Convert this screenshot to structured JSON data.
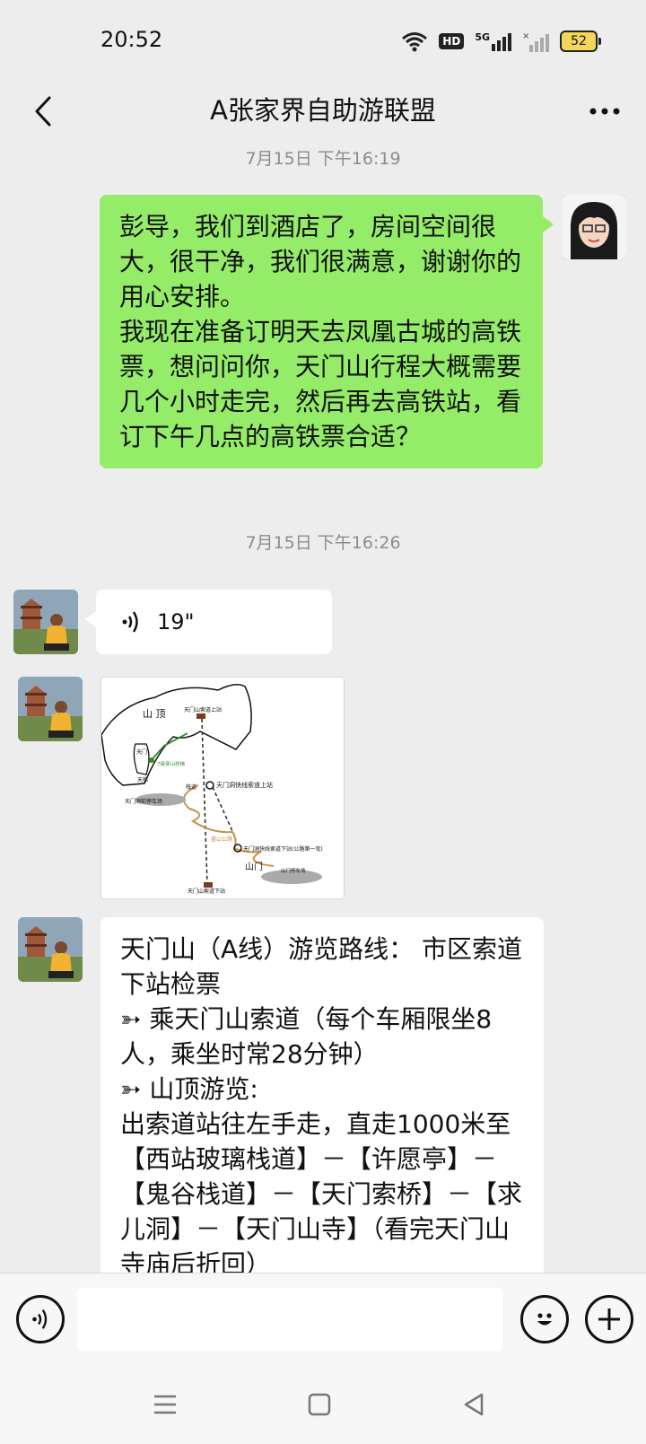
{
  "status_bar": {
    "time": "20:52",
    "hd_label": "HD",
    "net_label": "5G",
    "battery": "52"
  },
  "header": {
    "title": "A张家界自助游联盟"
  },
  "messages": {
    "ts1": "7月15日 下午16:19",
    "me_text_p1": "彭导，我们到酒店了，房间空间很大，很干净，我们很满意，谢谢你的用心安排。",
    "me_text_p2": "我现在准备订明天去凤凰古城的高铁票，想问问你，天门山行程大概需要几个小时走完，然后再去高铁站，看订下午几点的高铁票合适？",
    "ts2": "7月15日 下午16:26",
    "voice_duration": "19\"",
    "route_lines": [
      "天门山（A线）游览路线：  市区索道下站检票",
      "➳ 乘天门山索道（每个车厢限坐8人，乘坐时常28分钟）",
      "➳ 山顶游览:",
      "出索道站往左手走，直走1000米至【西站玻璃栈道】－【许愿亭】－【鬼谷栈道】－【天门索桥】－【求儿洞】－【天门山寺】（看完天门山寺庙后折回）"
    ]
  },
  "map": {
    "labels": {
      "summit": "山  顶",
      "cable_top": "天门山索道上站",
      "tianmen": "天门",
      "escalator": "7级穿山扶梯",
      "stairs": "天梯",
      "plank": "栈道",
      "express_top": "天门洞快线索道上站",
      "cave_parking": "天门洞前停车场",
      "road": "盘山公路",
      "express_bottom": "天门洞快线索道下站(公路第一弯)",
      "gate": "山门",
      "gate_parking": "山门停车场",
      "cable_bottom": "天门山索道下站"
    },
    "colors": {
      "cable": "#333333",
      "escalator": "#2e8b2e",
      "road": "#c8924a"
    }
  },
  "input": {
    "placeholder": ""
  },
  "colors": {
    "my_bubble": "#95ec69",
    "background": "#ededed"
  }
}
